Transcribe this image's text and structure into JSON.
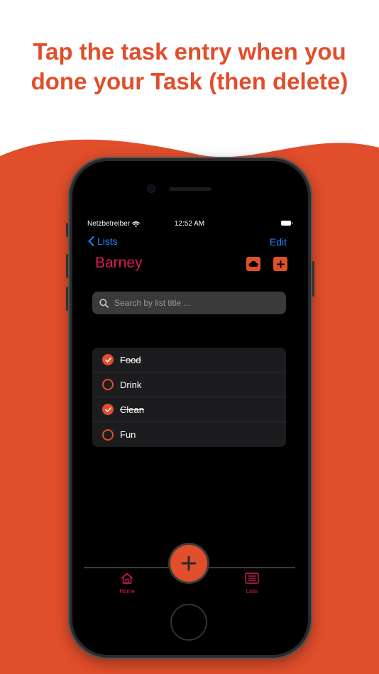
{
  "headline": {
    "line1": "Tap the task entry when you",
    "line2": "done your Task (then delete)"
  },
  "colors": {
    "accent": "#e04e2b",
    "title": "#e0195a",
    "link": "#1f86ff",
    "background": "#000000"
  },
  "status_bar": {
    "carrier": "Netzbetreiber",
    "time": "12:52 AM"
  },
  "nav": {
    "back_label": "Lists",
    "edit_label": "Edit"
  },
  "list": {
    "title": "Barney"
  },
  "search": {
    "placeholder": "Search by list title ..."
  },
  "tasks": [
    {
      "label": "Food",
      "done": true
    },
    {
      "label": "Drink",
      "done": false
    },
    {
      "label": "Clean",
      "done": true
    },
    {
      "label": "Fun",
      "done": false
    }
  ],
  "tabbar": {
    "home_label": "Home",
    "lists_label": "Lists"
  },
  "icons": {
    "back": "chevron-left-icon",
    "cloud": "cloud-icon",
    "add": "plus-icon",
    "search": "search-icon",
    "check": "checkmark-icon",
    "home": "house-icon",
    "lists": "list-icon",
    "fab": "plus-icon",
    "wifi": "wifi-icon",
    "battery": "battery-icon"
  }
}
